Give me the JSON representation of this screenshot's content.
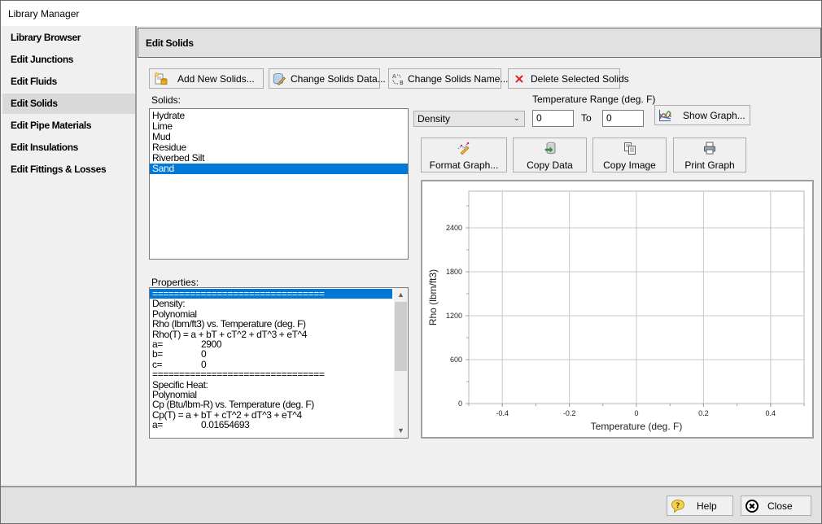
{
  "window": {
    "title": "Library Manager"
  },
  "sidebar": {
    "items": [
      {
        "label": "Library Browser",
        "active": false
      },
      {
        "label": "Edit Junctions",
        "active": false
      },
      {
        "label": "Edit Fluids",
        "active": false
      },
      {
        "label": "Edit Solids",
        "active": true
      },
      {
        "label": "Edit Pipe Materials",
        "active": false
      },
      {
        "label": "Edit Insulations",
        "active": false
      },
      {
        "label": "Edit Fittings & Losses",
        "active": false
      }
    ]
  },
  "header": {
    "title": "Edit Solids"
  },
  "toolbar": {
    "add_label": "Add New Solids...",
    "change_data_label": "Change Solids Data...",
    "change_name_label": "Change Solids Name...",
    "delete_label": "Delete Selected Solids"
  },
  "solids": {
    "label": "Solids:",
    "items": [
      "Hydrate",
      "Lime",
      "Mud",
      "Residue",
      "Riverbed Silt",
      "Sand"
    ],
    "selected": "Sand"
  },
  "properties": {
    "label": "Properties:",
    "lines": [
      "================================",
      "Density:",
      "Polynomial",
      "Rho (lbm/ft3) vs. Temperature (deg. F)",
      "Rho(T) = a + bT + cT^2 + dT^3 + eT^4",
      {
        "k": "a=",
        "v": "2900"
      },
      {
        "k": "b=",
        "v": "0"
      },
      {
        "k": "c=",
        "v": "0"
      },
      "================================",
      "Specific Heat:",
      "Polynomial",
      "Cp (Btu/lbm-R) vs. Temperature (deg. F)",
      "Cp(T) = a + bT + cT^2 + dT^3 + eT^4",
      {
        "k": "a=",
        "v": "0.01654693"
      }
    ]
  },
  "graph_controls": {
    "property_select": "Density",
    "temp_range_label": "Temperature Range (deg. F)",
    "temp_from": "0",
    "to_label": "To",
    "temp_to": "0",
    "show_graph_label": "Show Graph...",
    "format_graph_label": "Format Graph...",
    "copy_data_label": "Copy Data",
    "copy_image_label": "Copy Image",
    "print_graph_label": "Print Graph"
  },
  "chart_data": {
    "type": "line",
    "title": "",
    "xlabel": "Temperature (deg. F)",
    "ylabel": "Rho (lbm/ft3)",
    "xlim": [
      -0.5,
      0.5
    ],
    "ylim": [
      0,
      2900
    ],
    "xticks": [
      -0.4,
      -0.2,
      0,
      0.2,
      0.4
    ],
    "xtick_labels": [
      "-0.4",
      "-0.2",
      "0",
      "0.2",
      "0.4"
    ],
    "yticks": [
      0,
      600,
      1200,
      1800,
      2400
    ],
    "ytick_labels": [
      "0",
      "600",
      "1200",
      "1800",
      "2400"
    ],
    "grid": true,
    "series": []
  },
  "footer": {
    "help_label": "Help",
    "close_label": "Close"
  }
}
